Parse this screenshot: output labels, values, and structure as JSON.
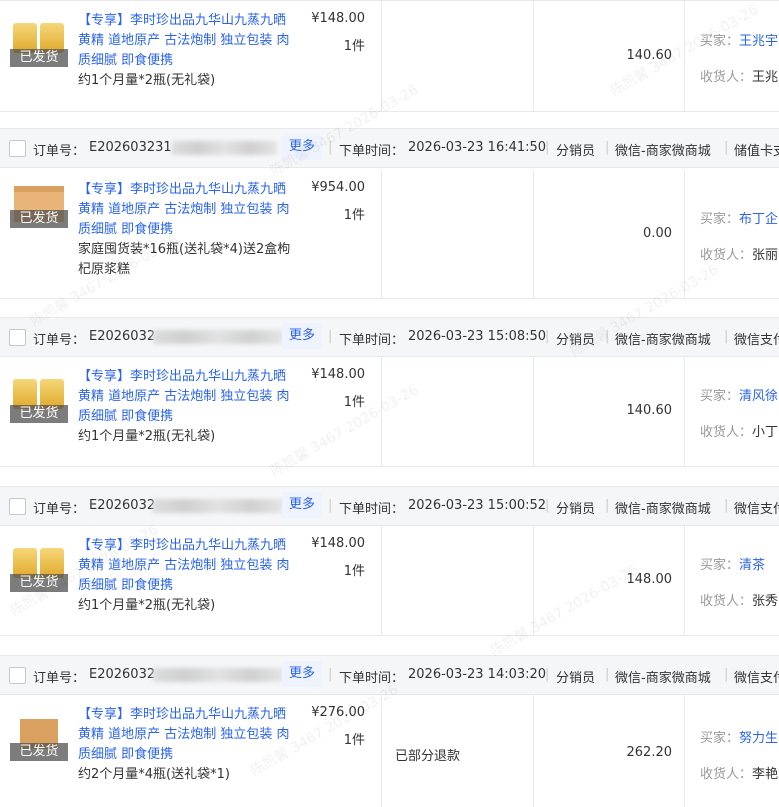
{
  "labels": {
    "order_no": "订单号：",
    "more": "更多",
    "order_time": "下单时间：",
    "buyer": "买家：",
    "receiver": "收货人：",
    "shipped_badge": "已发货"
  },
  "product_title": "【专享】李时珍出品九华山九蒸九晒黄精 道地原产 古法炮制 独立包装 肉质细腻 即食便携",
  "watermark": "陈凯馨 3467 2026-03-26",
  "orders": [
    {
      "order_no": "",
      "time": "",
      "source": "",
      "channel": "",
      "payment": "",
      "price": "¥148.00",
      "qty": "1件",
      "spec": "约1个月量*2瓶(无礼袋)",
      "amount": "140.60",
      "status": "",
      "buyer": "王兆宇",
      "receiver": "王兆",
      "image": "jars"
    },
    {
      "order_no": "E202603231",
      "time": "2026-03-23 16:41:50",
      "source": "分销员",
      "channel": "微信-商家微商城",
      "payment": "储值卡支付",
      "price": "¥954.00",
      "qty": "1件",
      "spec": "家庭囤货装*16瓶(送礼袋*4)送2盒枸杞原浆糕",
      "amount": "0.00",
      "status": "",
      "buyer": "布丁企",
      "receiver": "张丽",
      "image": "bags"
    },
    {
      "order_no": "E2026032",
      "time": "2026-03-23 15:08:50",
      "source": "分销员",
      "channel": "微信-商家微商城",
      "payment": "微信支付",
      "price": "¥148.00",
      "qty": "1件",
      "spec": "约1个月量*2瓶(无礼袋)",
      "amount": "140.60",
      "status": "",
      "buyer": "清风徐",
      "receiver": "小丁",
      "image": "jars"
    },
    {
      "order_no": "E2026032",
      "time": "2026-03-23 15:00:52",
      "source": "分销员",
      "channel": "微信-商家微商城",
      "payment": "微信支付",
      "price": "¥148.00",
      "qty": "1件",
      "spec": "约1个月量*2瓶(无礼袋)",
      "amount": "148.00",
      "status": "",
      "buyer": "清茶",
      "receiver": "张秀",
      "image": "jars"
    },
    {
      "order_no": "E2026032",
      "time": "2026-03-23 14:03:20",
      "source": "分销员",
      "channel": "微信-商家微商城",
      "payment": "微信支付",
      "price": "¥276.00",
      "qty": "1件",
      "spec": "约2个月量*4瓶(送礼袋*1)",
      "amount": "262.20",
      "status": "已部分退款",
      "buyer": "努力生",
      "receiver": "李艳",
      "image": "bag"
    }
  ]
}
